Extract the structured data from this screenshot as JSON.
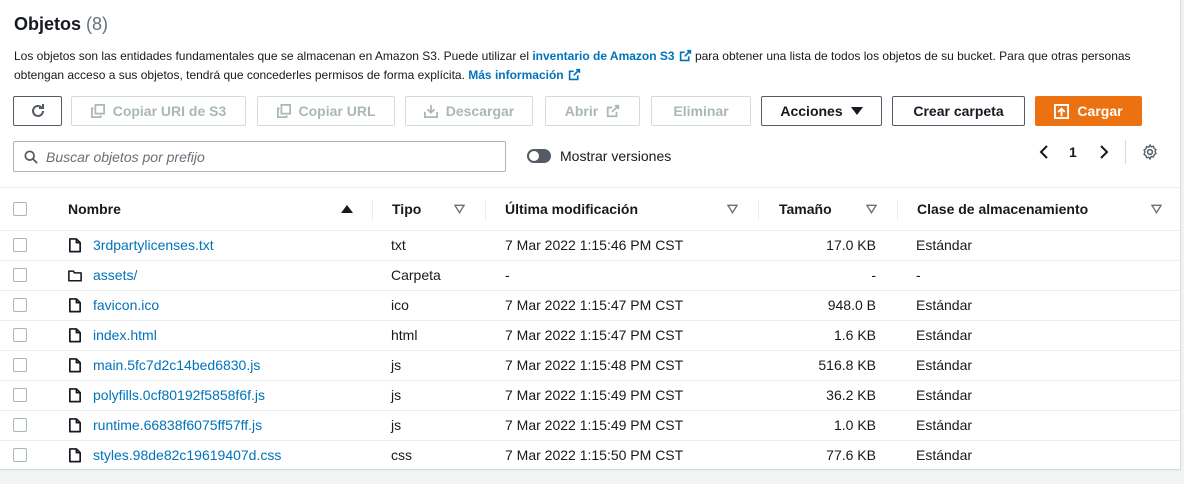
{
  "header": {
    "title": "Objetos",
    "count": "(8)"
  },
  "description": {
    "part1": "Los objetos son las entidades fundamentales que se almacenan en Amazon S3. Puede utilizar el ",
    "link1": "inventario de Amazon S3",
    "part2": " para obtener una lista de todos los objetos de su bucket. Para que otras personas obtengan acceso a sus objetos, tendrá que concederles permisos de forma explícita. ",
    "link2": "Más información"
  },
  "toolbar": {
    "copy_uri": "Copiar URI de S3",
    "copy_url": "Copiar URL",
    "download": "Descargar",
    "open": "Abrir",
    "delete": "Eliminar",
    "actions": "Acciones",
    "create_folder": "Crear carpeta",
    "upload": "Cargar"
  },
  "search": {
    "placeholder": "Buscar objetos por prefijo"
  },
  "versions_toggle": {
    "label": "Mostrar versiones"
  },
  "pagination": {
    "page": "1"
  },
  "table": {
    "columns": [
      "Nombre",
      "Tipo",
      "Última modificación",
      "Tamaño",
      "Clase de almacenamiento"
    ],
    "rows": [
      {
        "name": "3rdpartylicenses.txt",
        "type": "txt",
        "modified": "7 Mar 2022 1:15:46 PM CST",
        "size": "17.0 KB",
        "storage": "Estándar",
        "kind": "file"
      },
      {
        "name": "assets/",
        "type": "Carpeta",
        "modified": "-",
        "size": "-",
        "storage": "-",
        "kind": "folder"
      },
      {
        "name": "favicon.ico",
        "type": "ico",
        "modified": "7 Mar 2022 1:15:47 PM CST",
        "size": "948.0 B",
        "storage": "Estándar",
        "kind": "file"
      },
      {
        "name": "index.html",
        "type": "html",
        "modified": "7 Mar 2022 1:15:47 PM CST",
        "size": "1.6 KB",
        "storage": "Estándar",
        "kind": "file"
      },
      {
        "name": "main.5fc7d2c14bed6830.js",
        "type": "js",
        "modified": "7 Mar 2022 1:15:48 PM CST",
        "size": "516.8 KB",
        "storage": "Estándar",
        "kind": "file"
      },
      {
        "name": "polyfills.0cf80192f5858f6f.js",
        "type": "js",
        "modified": "7 Mar 2022 1:15:49 PM CST",
        "size": "36.2 KB",
        "storage": "Estándar",
        "kind": "file"
      },
      {
        "name": "runtime.66838f6075ff57ff.js",
        "type": "js",
        "modified": "7 Mar 2022 1:15:49 PM CST",
        "size": "1.0 KB",
        "storage": "Estándar",
        "kind": "file"
      },
      {
        "name": "styles.98de82c19619407d.css",
        "type": "css",
        "modified": "7 Mar 2022 1:15:50 PM CST",
        "size": "77.6 KB",
        "storage": "Estándar",
        "kind": "file"
      }
    ]
  },
  "colors": {
    "accent": "#ec7211",
    "link": "#0073bb",
    "text": "#16191f",
    "disabled": "#aab7b8"
  }
}
